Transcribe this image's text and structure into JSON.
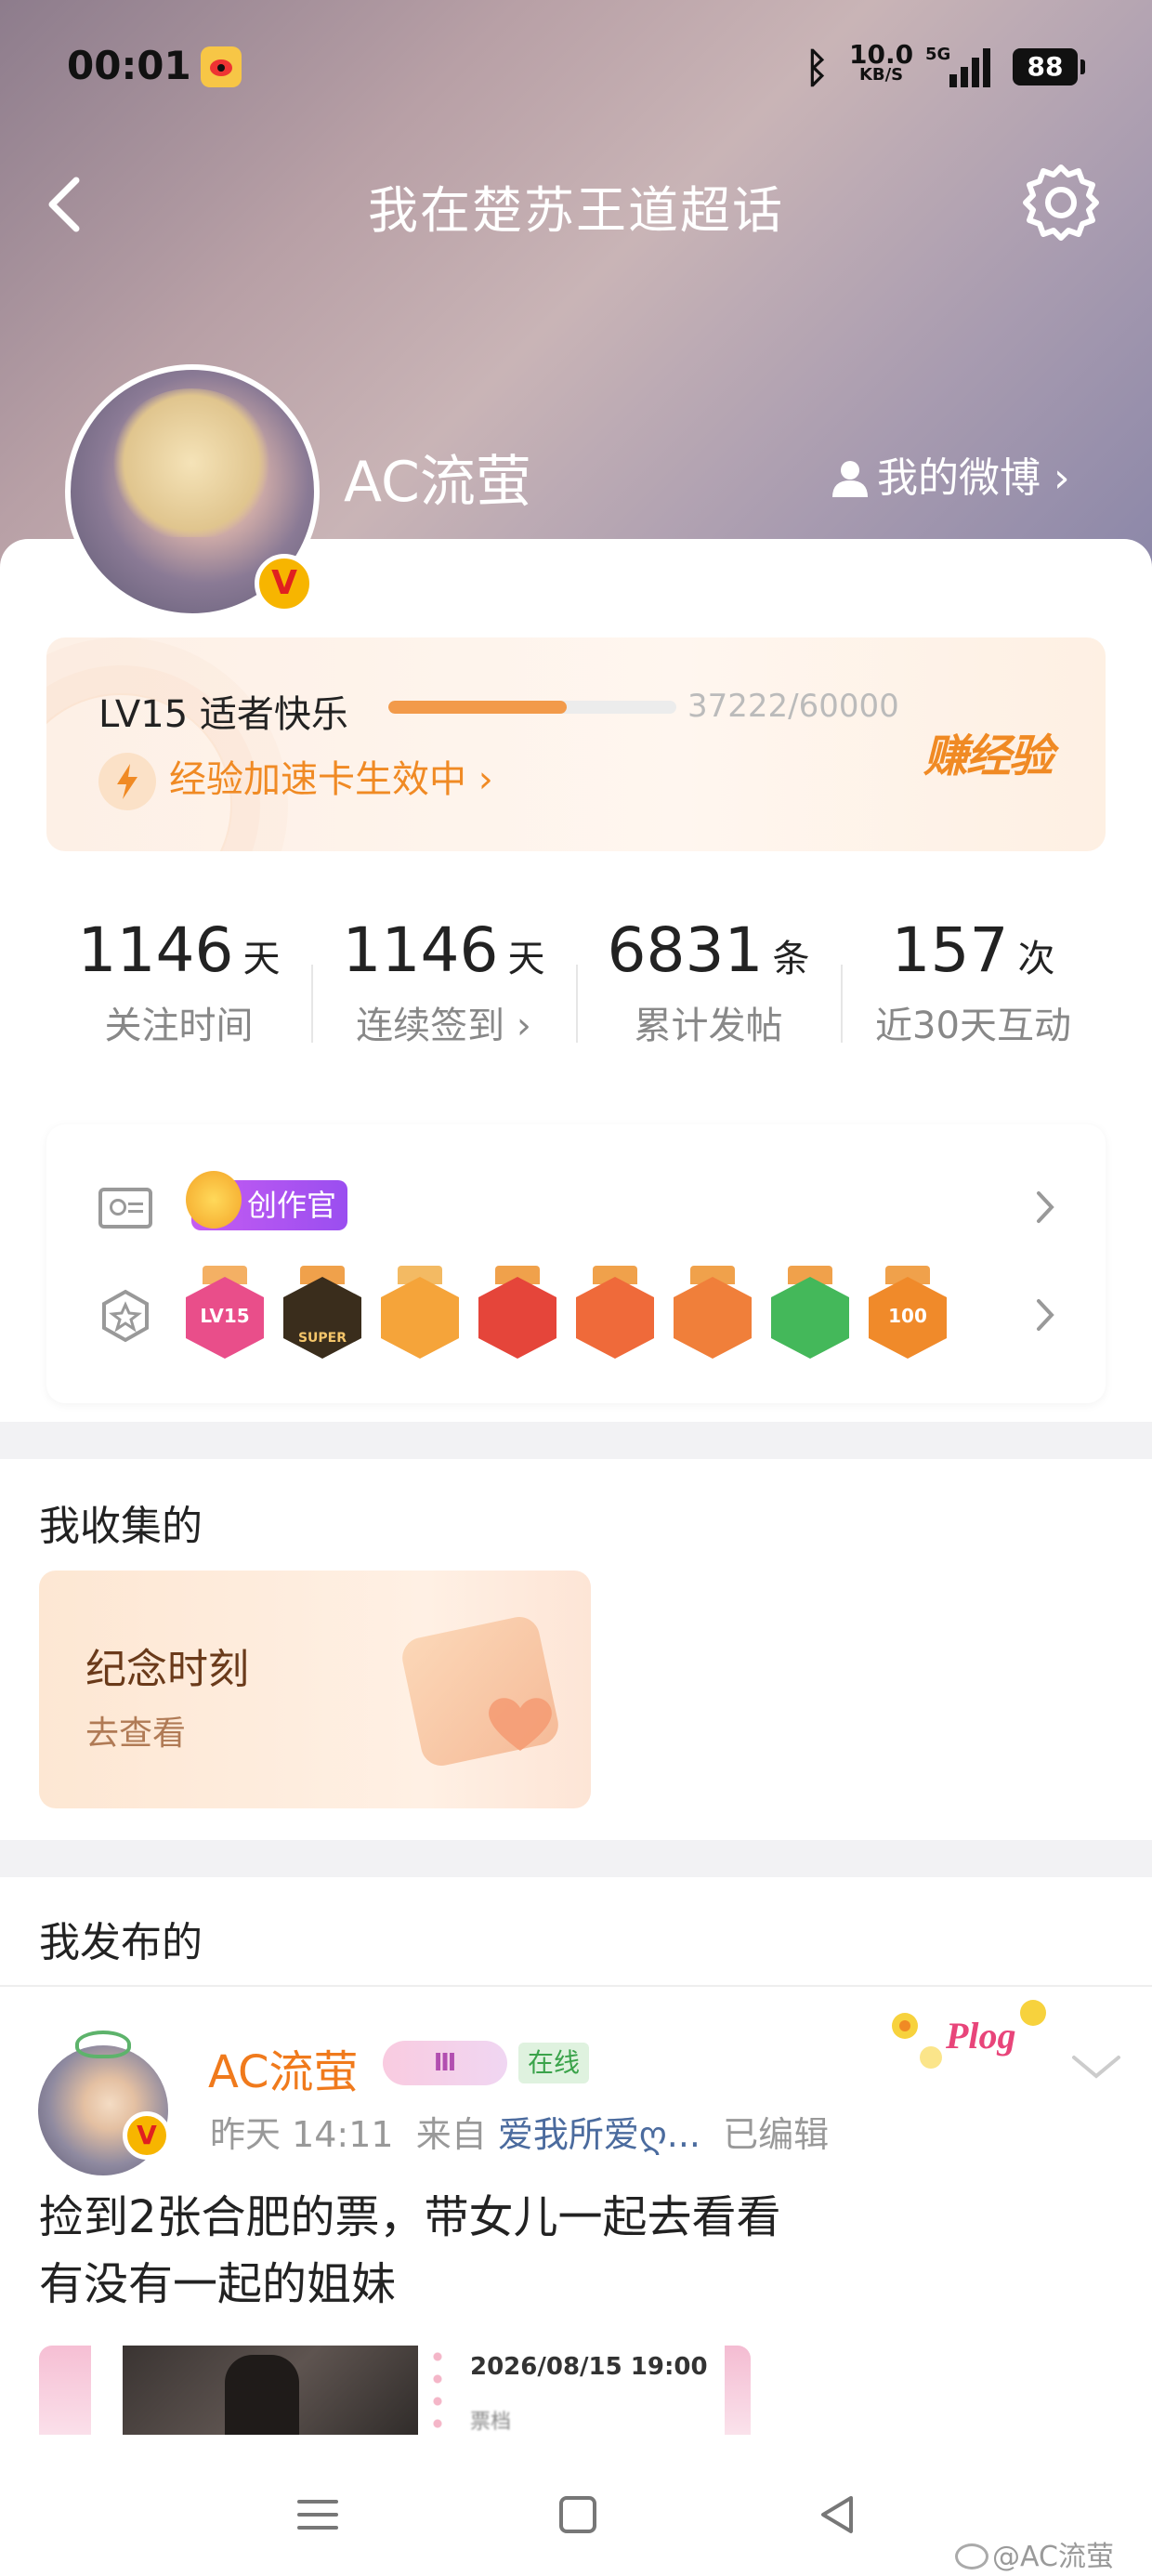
{
  "status_bar": {
    "time": "00:01",
    "app_icon": "weibo-icon",
    "bluetooth_icon": "bluetooth-icon",
    "net_speed": "10.0",
    "net_speed_unit": "KB/S",
    "network": "5G",
    "battery": "88"
  },
  "header": {
    "title": "我在楚苏王道超话",
    "back_icon": "back-arrow-icon",
    "settings_icon": "gear-icon"
  },
  "profile": {
    "username": "AC流萤",
    "verified_badge": "V",
    "my_weibo_label": "我的微博"
  },
  "level": {
    "title": "LV15 适者快乐",
    "progress_text": "37222/60000",
    "progress": 0.62,
    "boost_label": "经验加速卡生效中",
    "earn_label": "赚经验"
  },
  "stats": [
    {
      "num": "1146",
      "unit": "天",
      "label": "关注时间"
    },
    {
      "num": "1146",
      "unit": "天",
      "label": "连续签到"
    },
    {
      "num": "6831",
      "unit": "条",
      "label": "累计发帖"
    },
    {
      "num": "157",
      "unit": "次",
      "label": "近30天互动"
    }
  ],
  "badges": {
    "creator_tag": "创作官",
    "medals": [
      {
        "name": "lv15-medal",
        "text": "LV15",
        "color": "#e94e8a",
        "ribbon": "#f4b064"
      },
      {
        "name": "super-medal",
        "text": "SUPER",
        "color": "#3a2d1c",
        "ribbon": "#f0a14b"
      },
      {
        "name": "crown-medal",
        "text": "",
        "color": "#f5a43a",
        "ribbon": "#f3ba63"
      },
      {
        "name": "cat-red-medal",
        "text": "",
        "color": "#e5453a",
        "ribbon": "#f0a14b"
      },
      {
        "name": "cat-orange-medal",
        "text": "",
        "color": "#ef6a3a",
        "ribbon": "#f0a14b"
      },
      {
        "name": "cat-crown-medal",
        "text": "",
        "color": "#f07f3a",
        "ribbon": "#f0a14b"
      },
      {
        "name": "hand-medal",
        "text": "",
        "color": "#44b85a",
        "ribbon": "#f0a14b"
      },
      {
        "name": "100days-medal",
        "text": "100",
        "color": "#f08a2a",
        "ribbon": "#f0a14b"
      }
    ]
  },
  "collected": {
    "title": "我收集的",
    "card_title": "纪念时刻",
    "card_sub": "去查看"
  },
  "posted": {
    "title": "我发布的",
    "author": "AC流萤",
    "vip_level": "Ⅲ",
    "online": "在线",
    "time": "昨天 14:11",
    "from_prefix": "来自",
    "source": "爱我所爱ღ...",
    "edited": "已编辑",
    "text_line1": "捡到2张合肥的票，带女儿一起去看看",
    "text_line2": "有没有一起的姐妹",
    "ticket_date": "2026/08/15 19:00",
    "ticket_sub": "票档",
    "plog": "Plog"
  },
  "watermark": "@AC流萤",
  "colors": {
    "accent_orange": "#f08a24",
    "link_blue": "#4b6b9e",
    "progress": "#f29a4a"
  }
}
